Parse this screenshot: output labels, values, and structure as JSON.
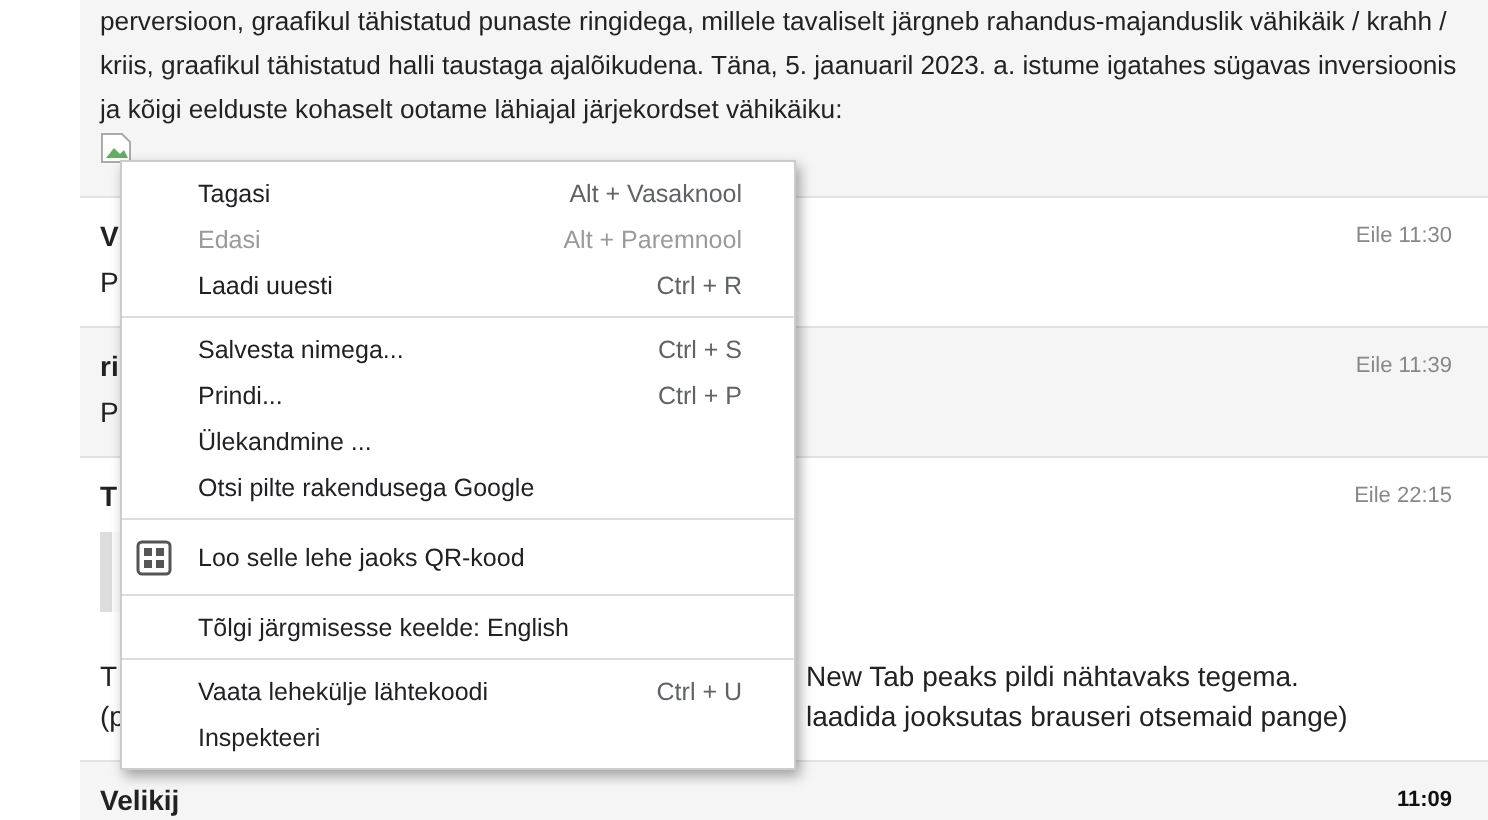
{
  "intro": {
    "lines": [
      "perversioon, graafikul tähistatud punaste ringidega, millele tavaliselt järgneb rahandus-majanduslik vähikäik / krahh /",
      "kriis, graafikul tähistatud halli taustaga ajalõikudena. Täna, 5. jaanuaril 2023. a. istume igatahes sügavas inversioonis",
      "ja kõigi eelduste kohaselt ootame lähiajal järjekordset vähikäiku:"
    ]
  },
  "posts": [
    {
      "author": "V",
      "time": "Eile 11:30",
      "unread": false,
      "body": [
        {
          "kind": "line",
          "left": "P"
        }
      ]
    },
    {
      "author": "ri",
      "time": "Eile 11:39",
      "unread": false,
      "body": [
        {
          "kind": "line",
          "left": "P"
        }
      ]
    },
    {
      "author": "T",
      "time": "Eile 22:15",
      "unread": false,
      "body": [
        {
          "kind": "quote"
        },
        {
          "kind": "line",
          "left": "T",
          "right": "New Tab peaks pildi nähtavaks tegema."
        },
        {
          "kind": "line",
          "left": "(p",
          "right": "laadida jooksutas brauseri otsemaid pange)"
        }
      ]
    },
    {
      "author": "Velikij",
      "time": "11:09",
      "unread": true
    }
  ],
  "context_menu": {
    "sections": [
      [
        {
          "kind": "plain",
          "label": "Tagasi",
          "shortcut": "Alt + Vasaknool",
          "disabled": false
        },
        {
          "kind": "plain",
          "label": "Edasi",
          "shortcut": "Alt + Paremnool",
          "disabled": true
        },
        {
          "kind": "plain",
          "label": "Laadi uuesti",
          "shortcut": "Ctrl + R",
          "disabled": false
        }
      ],
      [
        {
          "kind": "plain",
          "label": "Salvesta nimega...",
          "shortcut": "Ctrl + S",
          "disabled": false
        },
        {
          "kind": "plain",
          "label": "Prindi...",
          "shortcut": "Ctrl + P",
          "disabled": false
        },
        {
          "kind": "plain",
          "label": "Ülekandmine ...",
          "disabled": false
        },
        {
          "kind": "plain",
          "label": "Otsi pilte rakendusega Google",
          "disabled": false
        }
      ],
      [
        {
          "kind": "qr",
          "label": "Loo selle lehe jaoks QR-kood",
          "disabled": false
        }
      ],
      [
        {
          "kind": "plain",
          "label": "Tõlgi järgmisesse keelde: English",
          "disabled": false
        }
      ],
      [
        {
          "kind": "plain",
          "label": "Vaata lehekülje lähtekoodi",
          "shortcut": "Ctrl + U",
          "disabled": false
        },
        {
          "kind": "plain",
          "label": "Inspekteeri",
          "disabled": false
        }
      ]
    ]
  }
}
